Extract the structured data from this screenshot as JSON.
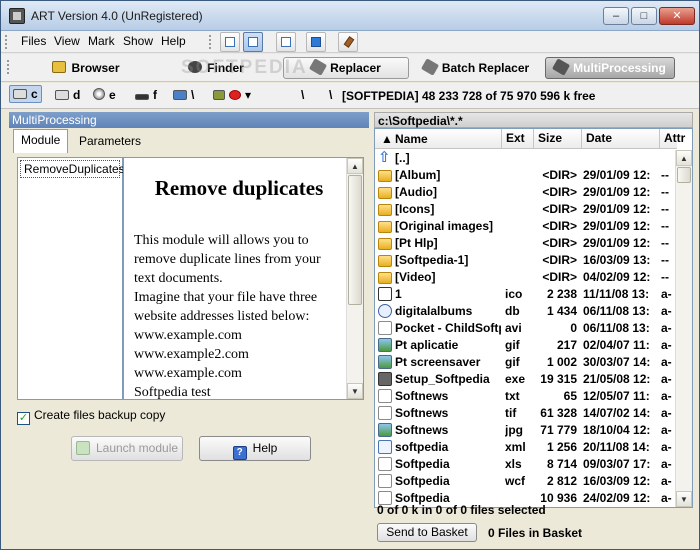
{
  "window": {
    "title": "ART Version 4.0 (UnRegistered)",
    "minimize": "–",
    "maximize": "□",
    "close": "✕"
  },
  "menu": [
    "Files",
    "View",
    "Mark",
    "Show",
    "Help"
  ],
  "big_tabs": {
    "browser": "Browser",
    "finder": "Finder",
    "replacer": "Replacer",
    "batch_replacer": "Batch Replacer",
    "multiprocessing": "MultiProcessing"
  },
  "watermark": "SOFTPEDIA",
  "drives": {
    "c": "c",
    "d": "d",
    "e": "e",
    "f": "f",
    "net": "\\",
    "root": "\\"
  },
  "drive_info": "[SOFTPEDIA]  48 233 728 of 75 970 596 k free",
  "left_pane": {
    "header": "MultiProcessing",
    "tabs": [
      "Module",
      "Parameters"
    ],
    "modules": [
      "RemoveDuplicates"
    ],
    "desc_title": "Remove duplicates",
    "desc_lines": [
      "This module will allows you to",
      "remove duplicate lines from your",
      "text documents.",
      "Imagine that your file have three",
      "website addresses listed below:",
      "www.example.com",
      "www.example2.com",
      "www.example.com",
      "Softpedia test"
    ],
    "backup_label": "Create files backup copy",
    "backup_checked": "✓",
    "launch_label": "Launch module",
    "help_label": "Help"
  },
  "right_pane": {
    "path": "c:\\Softpedia\\*.*",
    "columns": [
      "Name",
      "Ext",
      "Size",
      "Date",
      "Attr"
    ],
    "files": [
      {
        "icon": "up",
        "name": "[..]",
        "ext": "",
        "size": "",
        "date": "",
        "attr": ""
      },
      {
        "icon": "folder",
        "name": "[Album]",
        "ext": "",
        "size": "<DIR>",
        "date": "29/01/09 12:",
        "attr": "--"
      },
      {
        "icon": "folder",
        "name": "[Audio]",
        "ext": "",
        "size": "<DIR>",
        "date": "29/01/09 12:",
        "attr": "--"
      },
      {
        "icon": "folder",
        "name": "[Icons]",
        "ext": "",
        "size": "<DIR>",
        "date": "29/01/09 12:",
        "attr": "--"
      },
      {
        "icon": "folder",
        "name": "[Original images]",
        "ext": "",
        "size": "<DIR>",
        "date": "29/01/09 12:",
        "attr": "--"
      },
      {
        "icon": "folder",
        "name": "[Pt Hlp]",
        "ext": "",
        "size": "<DIR>",
        "date": "29/01/09 12:",
        "attr": "--"
      },
      {
        "icon": "folder",
        "name": "[Softpedia-1]",
        "ext": "",
        "size": "<DIR>",
        "date": "16/03/09 13:",
        "attr": "--"
      },
      {
        "icon": "folder",
        "name": "[Video]",
        "ext": "",
        "size": "<DIR>",
        "date": "04/02/09 12:",
        "attr": "--"
      },
      {
        "icon": "ico",
        "name": "1",
        "ext": "ico",
        "size": "2 238",
        "date": "11/11/08 13:",
        "attr": "a-"
      },
      {
        "icon": "db",
        "name": "digitalalbums",
        "ext": "db",
        "size": "1 434",
        "date": "06/11/08 13:",
        "attr": "a-"
      },
      {
        "icon": "doc",
        "name": "Pocket - ChildSoftp",
        "ext": "avi",
        "size": "0",
        "date": "06/11/08 13:",
        "attr": "a-"
      },
      {
        "icon": "img",
        "name": "Pt aplicatie",
        "ext": "gif",
        "size": "217",
        "date": "02/04/07 11:",
        "attr": "a-"
      },
      {
        "icon": "img",
        "name": "Pt screensaver",
        "ext": "gif",
        "size": "1 002",
        "date": "30/03/07 14:",
        "attr": "a-"
      },
      {
        "icon": "exe",
        "name": "Setup_Softpedia",
        "ext": "exe",
        "size": "19 315",
        "date": "21/05/08 12:",
        "attr": "a-"
      },
      {
        "icon": "doc",
        "name": "Softnews",
        "ext": "txt",
        "size": "65",
        "date": "12/05/07 11:",
        "attr": "a-"
      },
      {
        "icon": "doc",
        "name": "Softnews",
        "ext": "tif",
        "size": "61 328",
        "date": "14/07/02 14:",
        "attr": "a-"
      },
      {
        "icon": "img",
        "name": "Softnews",
        "ext": "jpg",
        "size": "71 779",
        "date": "18/10/04 12:",
        "attr": "a-"
      },
      {
        "icon": "xml",
        "name": "softpedia",
        "ext": "xml",
        "size": "1 256",
        "date": "20/11/08 14:",
        "attr": "a-"
      },
      {
        "icon": "doc",
        "name": "Softpedia",
        "ext": "xls",
        "size": "8 714",
        "date": "09/03/07 17:",
        "attr": "a-"
      },
      {
        "icon": "doc",
        "name": "Softpedia",
        "ext": "wcf",
        "size": "2 812",
        "date": "16/03/09 12:",
        "attr": "a-"
      },
      {
        "icon": "doc",
        "name": "Softpedia",
        "ext": "",
        "size": "10 936",
        "date": "24/02/09 12:",
        "attr": "a-"
      }
    ],
    "selection_status": "0 of 0 k in 0 of 0 files selected",
    "send_basket": "Send to Basket",
    "basket_info": "0 Files in Basket"
  }
}
